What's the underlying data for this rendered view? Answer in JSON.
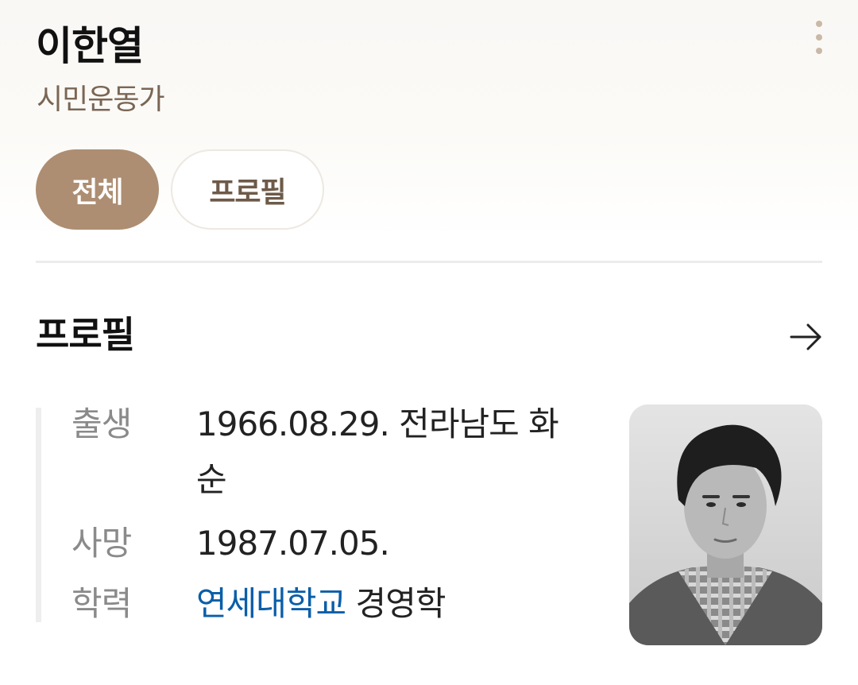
{
  "header": {
    "name": "이한열",
    "subtitle": "시민운동가",
    "more_icon": "more-vertical-icon"
  },
  "tabs": [
    {
      "label": "전체",
      "active": true
    },
    {
      "label": "프로필",
      "active": false
    }
  ],
  "profile": {
    "title": "프로필",
    "arrow_icon": "arrow-right-icon",
    "rows": [
      {
        "label": "출생",
        "value": "1966.08.29. 전라남도 화순"
      },
      {
        "label": "사망",
        "value": "1987.07.05."
      },
      {
        "label": "학력",
        "link": "연세대학교",
        "value": " 경영학"
      }
    ],
    "photo_icon": "portrait-photo"
  },
  "colors": {
    "accent": "#ad8e72",
    "subtitle": "#7a6655",
    "link": "#0a5ea8"
  }
}
